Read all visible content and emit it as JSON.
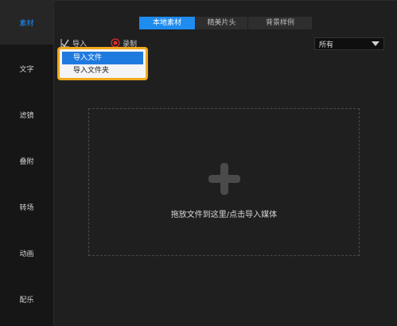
{
  "sidebar": {
    "items": [
      {
        "label": "素材"
      },
      {
        "label": "文字"
      },
      {
        "label": "滤镜"
      },
      {
        "label": "叠附"
      },
      {
        "label": "转场"
      },
      {
        "label": "动画"
      },
      {
        "label": "配乐"
      }
    ]
  },
  "tabs": [
    {
      "label": "本地素材"
    },
    {
      "label": "精美片头"
    },
    {
      "label": "背景样例"
    }
  ],
  "toolbar": {
    "import_label": "导入",
    "record_label": "录制"
  },
  "filter": {
    "selected": "所有"
  },
  "import_menu": {
    "items": [
      {
        "label": "导入文件"
      },
      {
        "label": "导入文件夹"
      }
    ]
  },
  "dropzone": {
    "text": "拖放文件到这里/点击导入媒体"
  },
  "colors": {
    "accent": "#1f8cf0",
    "highlight": "#f0a81c",
    "record": "#e0302a"
  }
}
